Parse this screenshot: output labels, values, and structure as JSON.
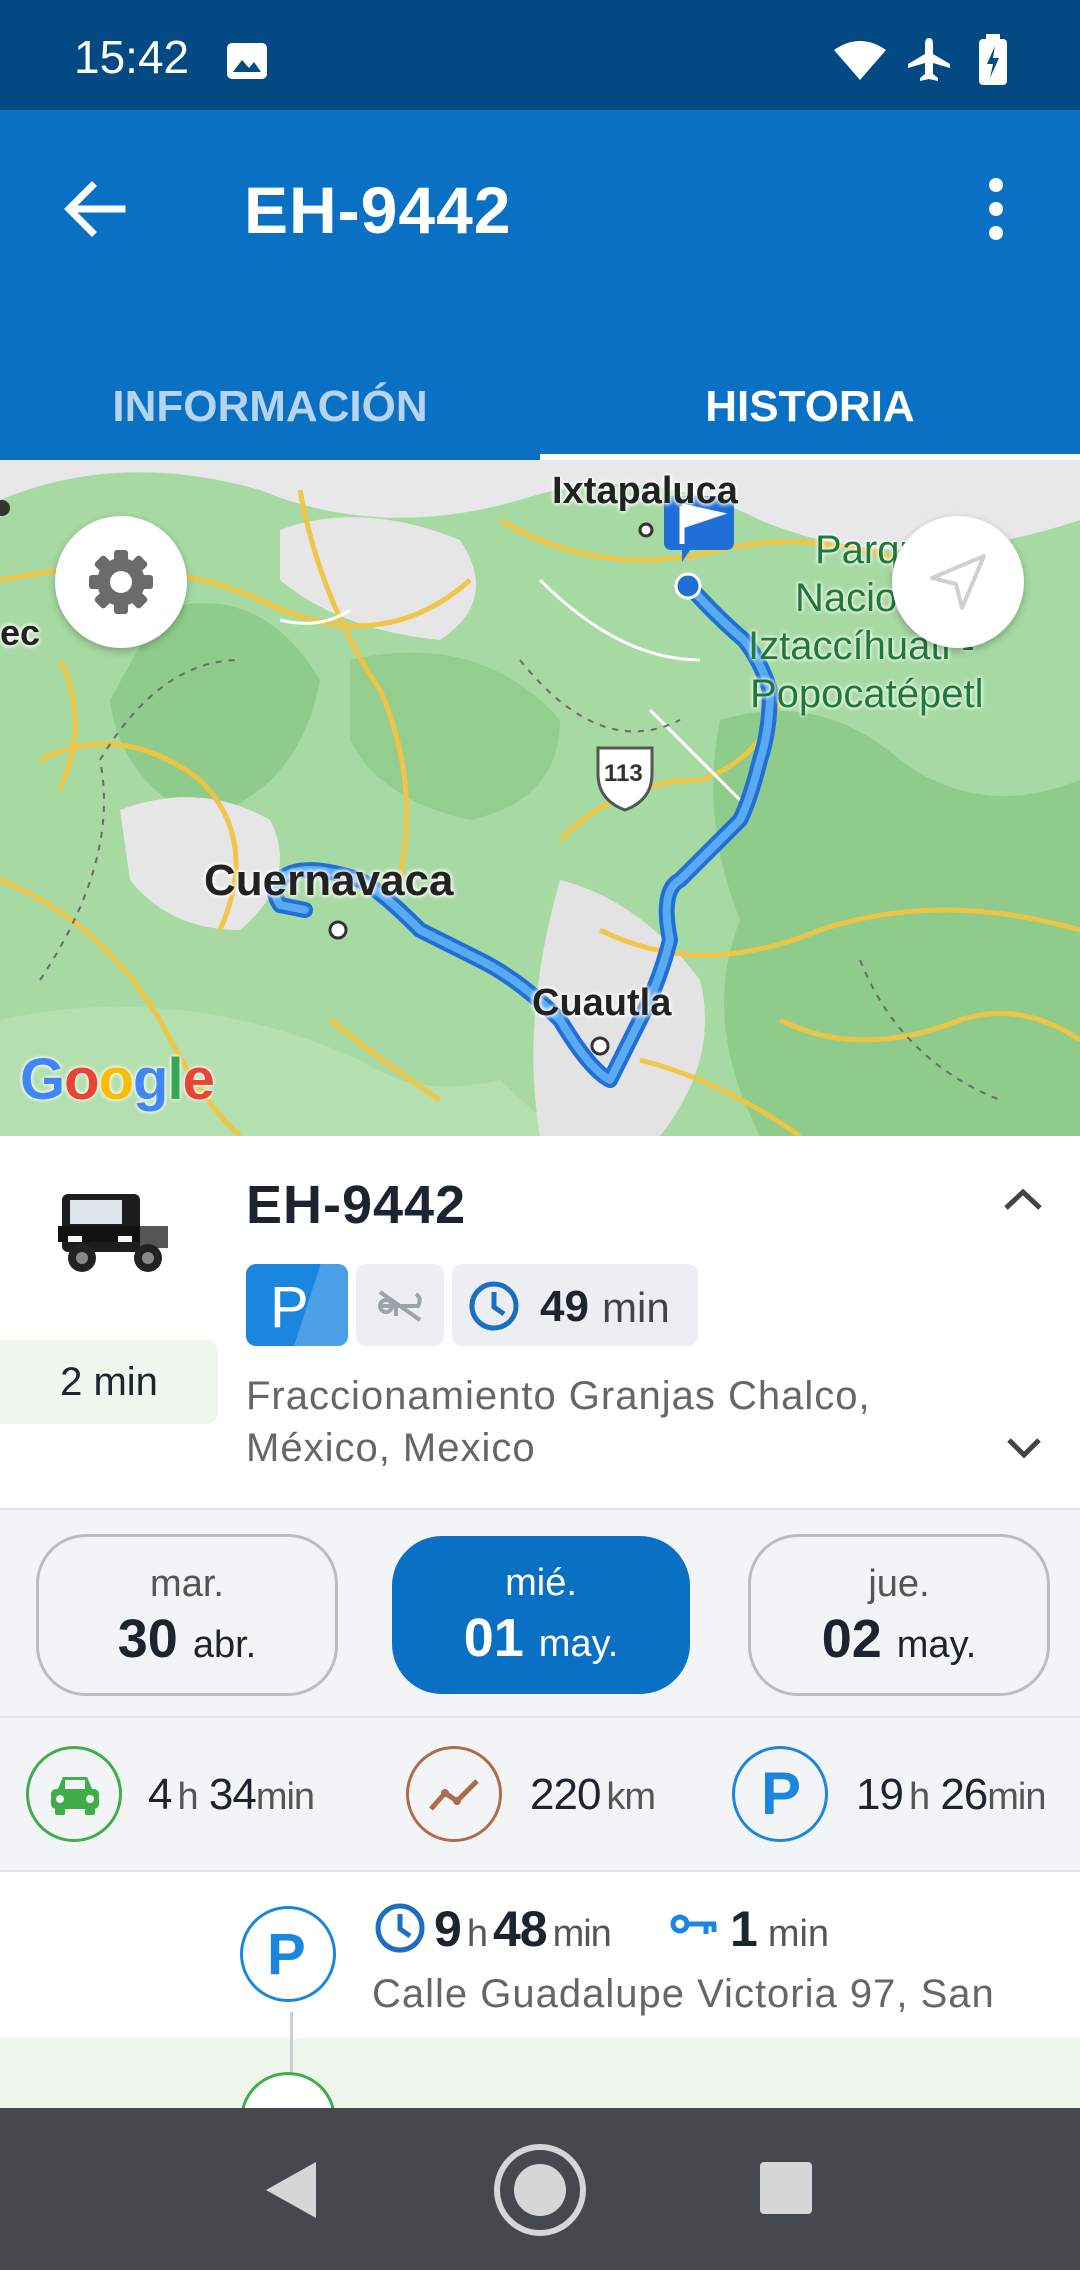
{
  "status_bar": {
    "time": "15:42"
  },
  "app_bar": {
    "title": "EH-9442"
  },
  "tabs": [
    {
      "label": "INFORMACIÓN",
      "selected": false
    },
    {
      "label": "HISTORIA",
      "selected": true
    }
  ],
  "map": {
    "labels": {
      "ixtapaluca": "Ixtapaluca",
      "park": [
        "Parque",
        "Nacional",
        "Iztaccíhuatl -",
        "Popocatépetl"
      ],
      "route_shield": "113",
      "cuernavaca": "Cuernavaca",
      "cuautla": "Cuautla",
      "edge": "ec",
      "google": "Google"
    }
  },
  "vehicle_card": {
    "name": "EH-9442",
    "elapsed": "2 min",
    "status_letter": "P",
    "duration_value": "49",
    "duration_unit": "min",
    "address_line1": "Fraccionamiento Granjas Chalco,",
    "address_line2": "México, Mexico"
  },
  "dates": [
    {
      "weekday": "mar.",
      "day": "30",
      "month": "abr.",
      "selected": false
    },
    {
      "weekday": "mié.",
      "day": "01",
      "month": "may.",
      "selected": true
    },
    {
      "weekday": "jue.",
      "day": "02",
      "month": "may.",
      "selected": false
    }
  ],
  "stats": {
    "driving": {
      "h": "4",
      "h_unit": "h",
      "m": "34",
      "m_unit": "min"
    },
    "distance": {
      "value": "220",
      "unit": "km"
    },
    "parked": {
      "h": "19",
      "h_unit": "h",
      "m": "26",
      "m_unit": "min"
    }
  },
  "timeline": {
    "entry": {
      "letter": "P",
      "dur_h": "9",
      "h_unit": "h",
      "dur_m": "48",
      "m_unit": "min",
      "key_value": "1",
      "key_unit": "min",
      "address": "Calle Guadalupe Victoria 97, San"
    }
  },
  "colors": {
    "status_bar": "#034a85",
    "app_bar": "#0a70c4",
    "accent": "#1a86e0",
    "driving": "#3fae4a",
    "distance": "#b06a4e"
  }
}
